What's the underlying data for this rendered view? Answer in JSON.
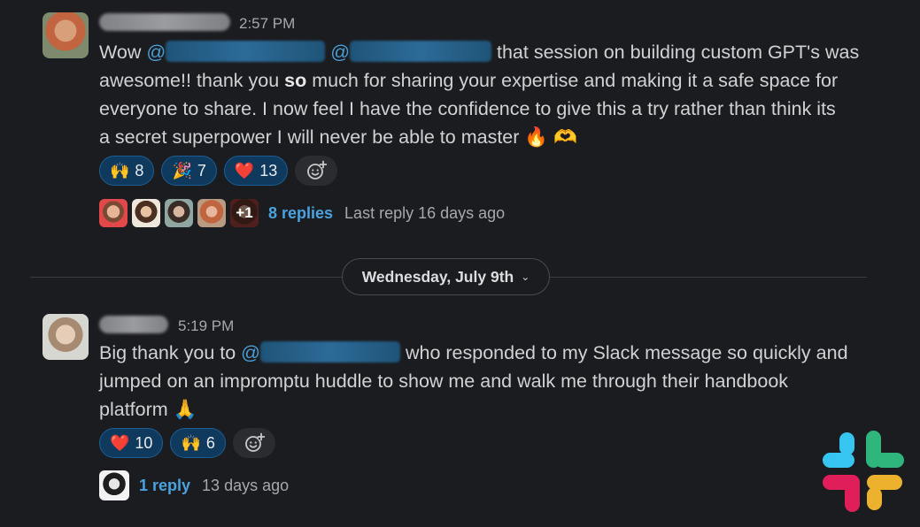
{
  "messages": [
    {
      "time": "2:57 PM",
      "line1_prefix": "Wow",
      "at1": "@",
      "at2": "@",
      "line1_suffix": "that session on building custom GPT's was",
      "line2_a": "awesome!! thank you",
      "line2_bold": "so",
      "line2_b": "much for sharing your expertise and making it a safe space for",
      "line3": "everyone to share. I now feel I have the confidence to give this a try rather than think its",
      "line4": "a secret superpower I will never be able to master",
      "trailing_emoji": "🔥 🫶",
      "reactions": [
        {
          "emoji": "🙌",
          "count": "8",
          "icon": "clapping-hands-icon"
        },
        {
          "emoji": "🎉",
          "count": "7",
          "icon": "party-popper-icon"
        },
        {
          "emoji": "❤️",
          "count": "13",
          "icon": "heart-icon"
        }
      ],
      "thread": {
        "plus_more": "+1",
        "replies_label": "8 replies",
        "last_reply": "Last reply 16 days ago"
      }
    },
    {
      "time": "5:19 PM",
      "line1_prefix": "Big thank you to",
      "at1": "@",
      "line1_suffix": "who responded to my Slack message so quickly and",
      "line2": "jumped on an impromptu huddle to show me and walk me through their handbook",
      "line3": "platform",
      "trailing_emoji": "🙏",
      "reactions": [
        {
          "emoji": "❤️",
          "count": "10",
          "icon": "heart-icon"
        },
        {
          "emoji": "🙌",
          "count": "6",
          "icon": "clapping-hands-icon"
        }
      ],
      "thread": {
        "replies_label": "1 reply",
        "last_reply": "13 days ago"
      }
    }
  ],
  "date_divider": {
    "label": "Wednesday, July 9th"
  },
  "colors": {
    "background": "#1b1c1f",
    "link": "#4aa3e0",
    "reaction_bg": "#0f3a5e"
  }
}
